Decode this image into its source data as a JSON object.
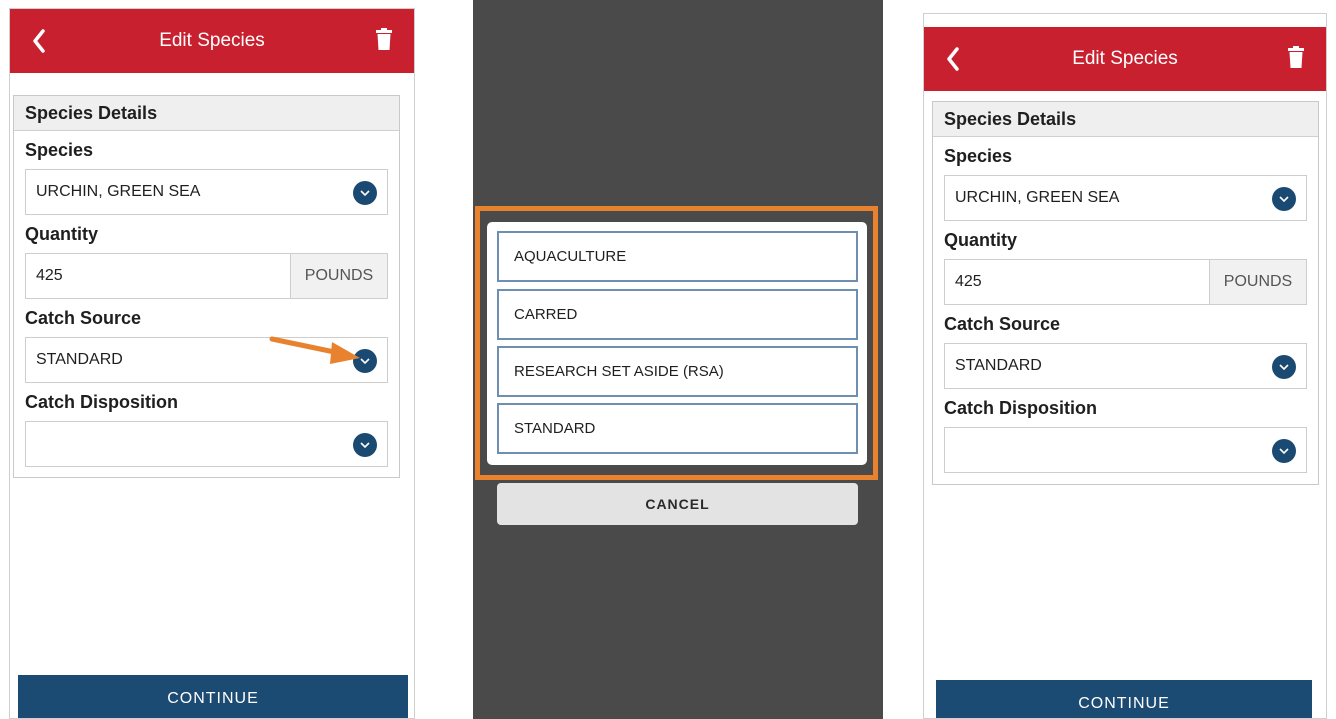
{
  "screens": [
    {
      "header": {
        "title": "Edit Species"
      },
      "section": "Species Details",
      "species": {
        "label": "Species",
        "value": "URCHIN, GREEN SEA"
      },
      "quantity": {
        "label": "Quantity",
        "value": "425",
        "unit": "POUNDS"
      },
      "catch_source": {
        "label": "Catch Source",
        "value": "STANDARD"
      },
      "catch_disposition": {
        "label": "Catch Disposition",
        "value": ""
      },
      "continue_label": "CONTINUE"
    },
    {
      "header": {
        "title": "Edit Species"
      },
      "section": "Species Details",
      "species": {
        "label": "Species",
        "value": "URCHIN, GREEN SEA"
      },
      "quantity": {
        "label": "Quantity",
        "value": "425",
        "unit": "POUNDS"
      },
      "catch_source": {
        "label": "Catch Source",
        "value": "STANDARD"
      },
      "catch_disposition": {
        "label": "Catch Disposition",
        "value": ""
      },
      "continue_label": "CONTINUE"
    }
  ],
  "picker": {
    "options": [
      "AQUACULTURE",
      "CARRED",
      "RESEARCH SET ASIDE (RSA)",
      "STANDARD"
    ],
    "cancel_label": "CANCEL"
  },
  "colors": {
    "header": "#c8202f",
    "primary": "#1b4a72",
    "highlight": "#e8822f",
    "overlay": "#4a4a4a"
  },
  "icons": [
    "chevron-left-icon",
    "trash-icon",
    "chevron-down-icon",
    "arrow-annotation-icon"
  ]
}
